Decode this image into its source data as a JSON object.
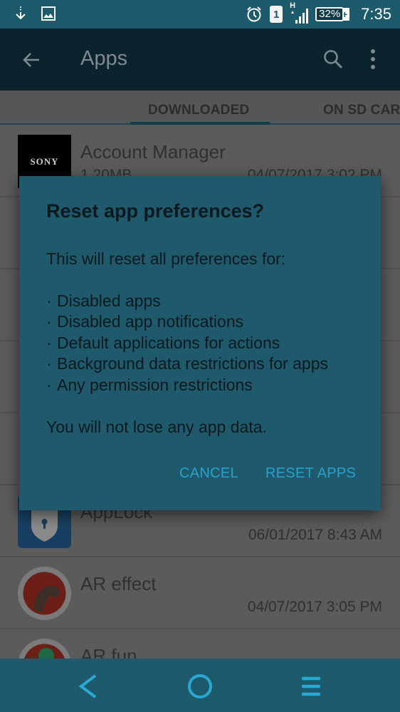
{
  "status_bar": {
    "time": "7:35",
    "battery_percent": "32%",
    "sim_slot": "1",
    "network_type": "H",
    "icons": [
      "download-icon",
      "image-icon",
      "alarm-icon",
      "sim-icon",
      "signal-icon",
      "battery-icon",
      "charging-icon"
    ]
  },
  "toolbar": {
    "title": "Apps",
    "back_icon": "arrow-left-icon",
    "search_icon": "search-icon",
    "more_icon": "more-vert-icon"
  },
  "tabs": [
    {
      "label": "DOWNLOADED",
      "selected": true
    },
    {
      "label": "ON SD CARD",
      "selected": false
    }
  ],
  "apps": [
    {
      "name": "Account Manager",
      "size": "1.20MB",
      "date": "04/07/2017 3:02 PM",
      "icon": "sony-icon",
      "icon_text": "SONY"
    },
    {
      "name": "",
      "size": "",
      "date": "",
      "icon": ""
    },
    {
      "name": "",
      "size": "",
      "date": "",
      "icon": ""
    },
    {
      "name": "",
      "size": "",
      "date": "",
      "icon": ""
    },
    {
      "name": "AppLock",
      "size": "",
      "date": "06/01/2017 8:43 AM",
      "icon": "lock-icon"
    },
    {
      "name": "AR effect",
      "size": "",
      "date": "04/07/2017 3:05 PM",
      "icon": "dinosaur-icon"
    },
    {
      "name": "AR fun",
      "size": "",
      "date": "",
      "icon": "ar-fun-icon"
    }
  ],
  "dialog": {
    "title": "Reset app preferences?",
    "intro": "This will reset all preferences for:",
    "items": [
      "Disabled apps",
      "Disabled app notifications",
      "Default applications for actions",
      "Background data restrictions for apps",
      "Any permission restrictions"
    ],
    "footer": "You will not lose any app data.",
    "cancel_label": "CANCEL",
    "confirm_label": "RESET APPS",
    "accent_color": "#2aa0c9",
    "background_color": "#1e5a6b"
  },
  "nav_bar": {
    "back_icon": "nav-back-icon",
    "home_icon": "nav-home-icon",
    "menu_icon": "nav-menu-icon"
  }
}
